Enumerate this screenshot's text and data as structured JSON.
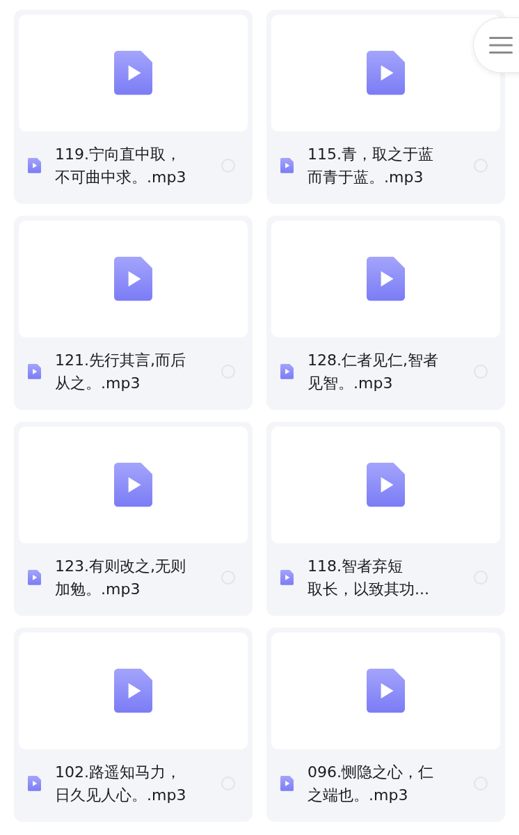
{
  "files": [
    {
      "lines": [
        "119.宁向直中取，",
        "不可曲中求。.mp3"
      ],
      "selected": false
    },
    {
      "lines": [
        "115.青，取之于蓝",
        "而青于蓝。.mp3"
      ],
      "selected": false
    },
    {
      "lines": [
        "121.先行其言,而后",
        "从之。.mp3"
      ],
      "selected": false
    },
    {
      "lines": [
        "128.仁者见仁,智者",
        "见智。.mp3"
      ],
      "selected": false
    },
    {
      "lines": [
        "123.有则改之,无则",
        "加勉。.mp3"
      ],
      "selected": false
    },
    {
      "lines": [
        "118.智者弃短",
        "取长，以致其功..."
      ],
      "selected": false
    },
    {
      "lines": [
        "102.路遥知马力，",
        "日久见人心。.mp3"
      ],
      "selected": false
    },
    {
      "lines": [
        "096.恻隐之心，仁",
        "之端也。.mp3"
      ],
      "selected": false
    }
  ]
}
